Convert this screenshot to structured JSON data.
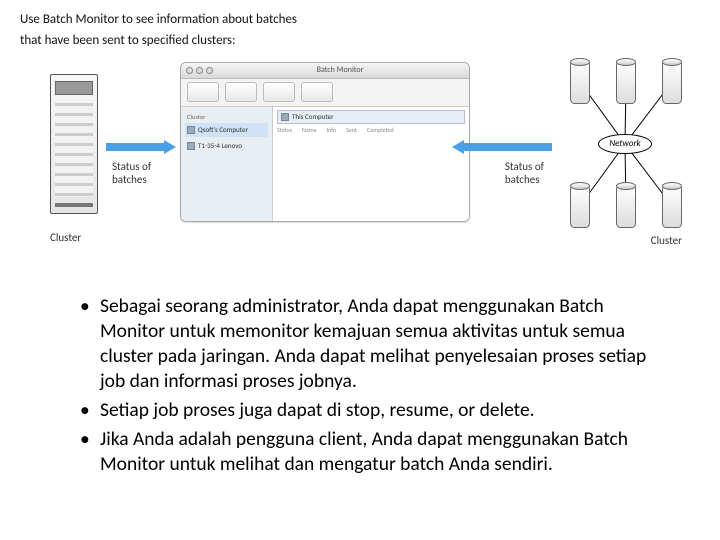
{
  "caption_line1": "Use Batch Monitor to see information about batches",
  "caption_line2": "that have been sent to specified clusters:",
  "left_cluster_label": "Cluster",
  "right_cluster_label": "Cluster",
  "status_left": "Status of\nbatches",
  "status_right": "Status of\nbatches",
  "network_label": "Network",
  "window": {
    "title": "Batch Monitor",
    "sidebar_section": "Cluster",
    "side_item1": "Qsoft's Computer",
    "side_item2": "T1-35-4 Lenovo",
    "content_head": "This Computer",
    "col1": "Status",
    "col2": "Name",
    "col3": "Info",
    "col4": "Sent",
    "col5": "Completed"
  },
  "bullet1": "Sebagai seorang administrator, Anda dapat menggunakan Batch Monitor untuk memonitor kemajuan semua aktivitas untuk semua cluster pada jaringan.  Anda dapat melihat penyelesaian proses setiap job dan informasi proses jobnya.",
  "bullet2": "Setiap job proses juga dapat di  stop, resume, or delete.",
  "bullet3": " Jika Anda adalah pengguna client, Anda dapat menggunakan Batch Monitor untuk melihat dan mengatur batch Anda sendiri."
}
